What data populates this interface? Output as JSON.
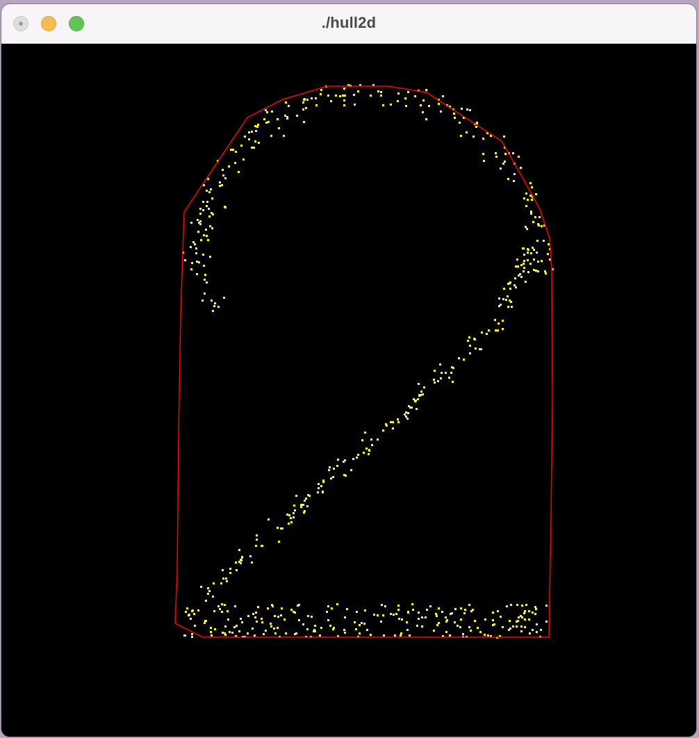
{
  "window": {
    "title": "./hull2d"
  },
  "titlebar": {
    "close_icon": "close-icon",
    "minimize_icon": "minimize-icon",
    "zoom_icon": "zoom-icon"
  },
  "colors": {
    "background": "#000000",
    "points": "#ffff00",
    "hull": "#ff0000",
    "titlebar": "#f7f5f7"
  }
}
